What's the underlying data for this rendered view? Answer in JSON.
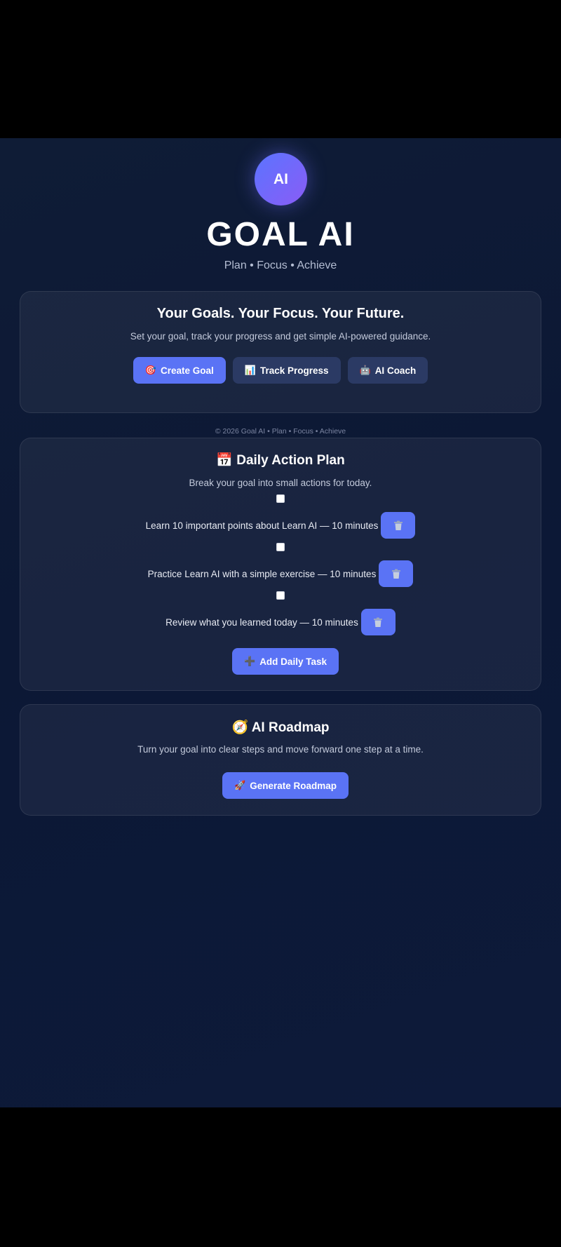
{
  "header": {
    "logo_text": "AI",
    "title": "GOAL AI",
    "tagline": "Plan • Focus • Achieve"
  },
  "hero": {
    "title": "Your Goals. Your Focus. Your Future.",
    "description": "Set your goal, track your progress and get simple AI-powered guidance.",
    "buttons": [
      {
        "emoji": "🎯",
        "label": "Create Goal",
        "icon": "target-icon"
      },
      {
        "emoji": "📊",
        "label": "Track Progress",
        "icon": "bar-chart-icon"
      },
      {
        "emoji": "🤖",
        "label": "AI Coach",
        "icon": "robot-icon"
      }
    ]
  },
  "footer_note": "© 2026 Goal AI • Plan • Focus • Achieve",
  "daily_plan": {
    "emoji": "📅",
    "title": "Daily Action Plan",
    "description": "Break your goal into small actions for today.",
    "tasks": [
      {
        "text": "Learn 10 important points about Learn AI — 10 minutes",
        "checked": false
      },
      {
        "text": "Practice Learn AI with a simple exercise — 10 minutes",
        "checked": false
      },
      {
        "text": "Review what you learned today — 10 minutes",
        "checked": false
      }
    ],
    "add_button": {
      "emoji": "➕",
      "label": "Add Daily Task",
      "icon": "plus-icon"
    }
  },
  "roadmap": {
    "emoji": "🧭",
    "title": "AI Roadmap",
    "description": "Turn your goal into clear steps and move forward one step at a time.",
    "button": {
      "emoji": "🚀",
      "label": "Generate Roadmap",
      "icon": "rocket-icon"
    }
  },
  "colors": {
    "accent": "#5a73f5",
    "secondary_button": "#2b3a64",
    "background": "#0c1835"
  }
}
